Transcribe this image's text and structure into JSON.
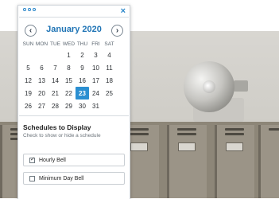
{
  "window": {
    "close_glyph": "×"
  },
  "calendar": {
    "prev_glyph": "‹",
    "next_glyph": "›",
    "month_title": "January 2020",
    "weekdays": [
      "SUN",
      "MON",
      "TUE",
      "WED",
      "THU",
      "FRI",
      "SAT"
    ],
    "weeks": [
      [
        "",
        "",
        "",
        "1",
        "2",
        "3",
        "4"
      ],
      [
        "5",
        "6",
        "7",
        "8",
        "9",
        "10",
        "11"
      ],
      [
        "12",
        "13",
        "14",
        "15",
        "16",
        "17",
        "18"
      ],
      [
        "19",
        "20",
        "21",
        "22",
        "23",
        "24",
        "25"
      ],
      [
        "26",
        "27",
        "28",
        "29",
        "30",
        "31",
        ""
      ]
    ],
    "selected_day": "23",
    "selected_color": "#2b8fd1"
  },
  "schedules": {
    "title": "Schedules to Display",
    "subtitle": "Check to show or hide a schedule",
    "items": [
      {
        "label": "Hourly Bell",
        "checked": true
      },
      {
        "label": "Minimum Day Bell",
        "checked": false
      }
    ]
  },
  "colors": {
    "accent": "#2a86c9"
  }
}
